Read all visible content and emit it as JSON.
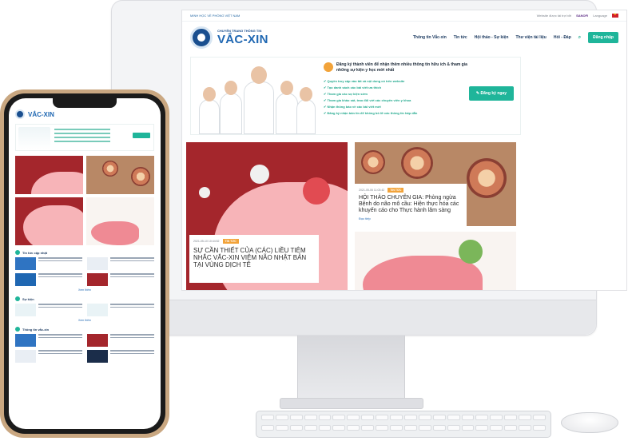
{
  "desktop": {
    "top_strip": {
      "left_text": "MINH HỌC VỀ PHÒNG VIỆT NAM",
      "sponsor_text": "Website được tài trợ bởi",
      "sponsor_name": "SANOFI",
      "language_label": "Language"
    },
    "logo": {
      "subtitle": "CHUYÊN TRANG THÔNG TIN",
      "name": "VẮC-XIN"
    },
    "nav": {
      "items": [
        "Thông tin Vắc-xin",
        "Tin tức",
        "Hội thảo - Sự kiện",
        "Thư viện tài liệu",
        "Hỏi - Đáp"
      ],
      "login": "Đăng nhập"
    },
    "banner": {
      "title": "Đăng ký thành viên để nhận thêm nhiều thông tin hữu ích & tham gia những sự kiện y học mới nhất",
      "bullets": [
        "Quyền truy cập vào tất cả nội dung có trên website",
        "Tạo danh sách các bài viết ưa thích",
        "Tham gia các sự kiện sớm",
        "Tham gia khảo sát, trao đổi với các chuyên viên y khoa",
        "Nhận thông báo về các bài viết mới",
        "Đăng ký nhận bản tin để không bỏ lỡ các thông tin hấp dẫn"
      ],
      "button": "Đăng ký ngay"
    },
    "article_left": {
      "date": "2021-05-10 10:44:52",
      "tag": "TIN TỨC",
      "title": "SỰ CẦN THIẾT CỦA (CÁC) LIỀU TIÊM NHẮC VẮC-XIN VIÊM NÃO NHẬT BẢN TẠI VÙNG DỊCH TỄ"
    },
    "article_right": {
      "date": "2021-05-06 11:03:42",
      "tag": "TIN TỨC",
      "title": "HỘI THẢO CHUYÊN GIA: Phòng ngừa Bệnh do não mô cầu: Hiện thực hóa các khuyến cáo cho Thực hành lâm sàng",
      "read_more": "Đọc tiếp"
    }
  },
  "phone": {
    "logo_name": "VẮC-XIN",
    "sections": [
      "Tin tức cập nhật",
      "Sự kiện",
      "Thông tin vắc-xin"
    ],
    "view_more": "Xem thêm"
  },
  "colors": {
    "brand_blue": "#1f67b2",
    "accent_green": "#1fb59a",
    "tag_orange": "#f2a33a",
    "hero_red": "#a4262c"
  }
}
